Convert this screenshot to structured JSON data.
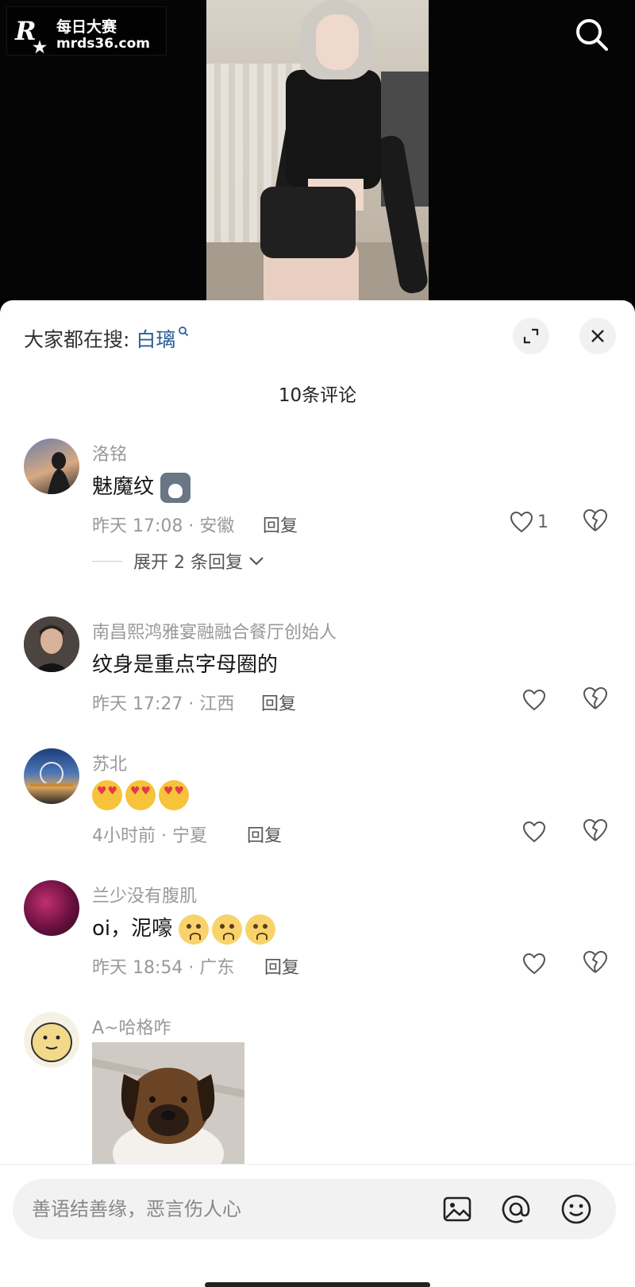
{
  "watermark": {
    "line1": "每日大赛",
    "line2": "mrds36.com",
    "mark": "R",
    "mark_small": "每日大赛"
  },
  "header": {
    "search_icon": "search-icon"
  },
  "sheet": {
    "trending_prefix": "大家都在搜:",
    "trending_keyword": "白璃",
    "comment_count_label": "10条评论",
    "expand_icon": "expand-icon",
    "close_icon": "close-icon"
  },
  "comments": [
    {
      "name": "洛铭",
      "text": "魅魔纹",
      "emoji": [
        "wolf-emoji"
      ],
      "meta": "昨天 17:08 · 安徽",
      "reply_label": "回复",
      "likes": "1",
      "expand_label": "展开 2 条回复"
    },
    {
      "name": "南昌熙鸿雅宴融融合餐厅创始人",
      "text": "纹身是重点字母圈的",
      "meta": "昨天 17:27 · 江西",
      "reply_label": "回复",
      "likes": ""
    },
    {
      "name": "苏北",
      "text": "",
      "emoji": [
        "heart-eyes-emoji",
        "heart-eyes-emoji",
        "heart-eyes-emoji"
      ],
      "meta": "4小时前 · 宁夏",
      "reply_label": "回复",
      "likes": ""
    },
    {
      "name": "兰少没有腹肌",
      "text": "oi，泥嚎",
      "emoji": [
        "crying-emoji",
        "crying-emoji",
        "crying-emoji"
      ],
      "meta": "昨天 18:54 · 广东",
      "reply_label": "回复",
      "likes": ""
    },
    {
      "name": "A~哈格咋",
      "text": "",
      "image": "puppy-photo"
    }
  ],
  "composer": {
    "placeholder": "善语结善缘，恶言伤人心",
    "image_icon": "image-icon",
    "mention_icon": "at-mention-icon",
    "emoji_icon": "emoji-icon"
  },
  "colors": {
    "keyword": "#2b5d9a",
    "secondary_text": "#999999",
    "sheet_bg": "#ffffff"
  }
}
